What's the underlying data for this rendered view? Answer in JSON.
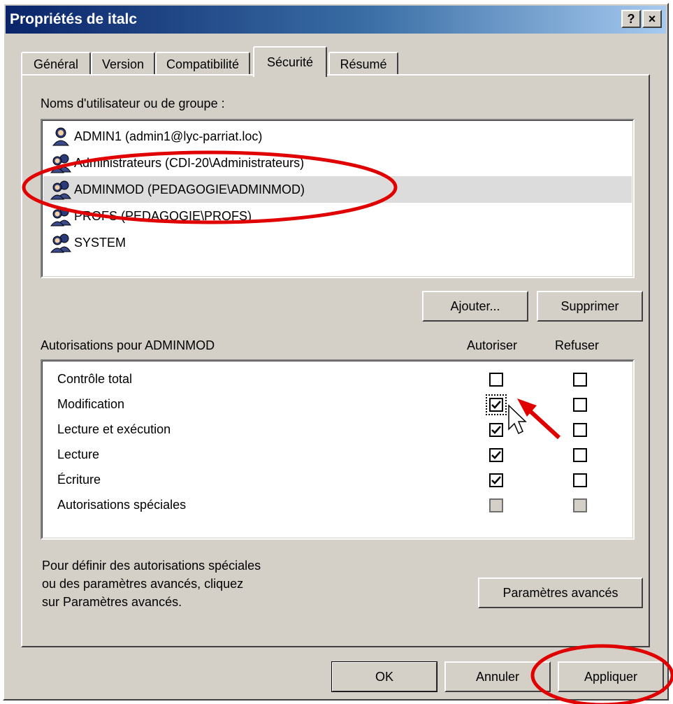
{
  "window": {
    "title": "Propriétés de italc",
    "help_label": "?",
    "close_label": "×"
  },
  "tabs": [
    {
      "label": "Général",
      "active": false
    },
    {
      "label": "Version",
      "active": false
    },
    {
      "label": "Compatibilité",
      "active": false
    },
    {
      "label": "Sécurité",
      "active": true
    },
    {
      "label": "Résumé",
      "active": false
    }
  ],
  "users": {
    "label": "Noms d'utilisateur ou de groupe :",
    "items": [
      {
        "name": "ADMIN1 (admin1@lyc-parriat.loc)",
        "icon": "user-icon",
        "selected": false
      },
      {
        "name": "Administrateurs (CDI-20\\Administrateurs)",
        "icon": "group-icon",
        "selected": false
      },
      {
        "name": "ADMINMOD (PEDAGOGIE\\ADMINMOD)",
        "icon": "group-icon",
        "selected": true
      },
      {
        "name": "PROFS (PEDAGOGIE\\PROFS)",
        "icon": "group-icon",
        "selected": false
      },
      {
        "name": "SYSTEM",
        "icon": "group-icon",
        "selected": false
      }
    ],
    "add_label": "Ajouter...",
    "remove_label": "Supprimer"
  },
  "permissions": {
    "label": "Autorisations pour ADMINMOD",
    "allow_header": "Autoriser",
    "deny_header": "Refuser",
    "rows": [
      {
        "name": "Contrôle total",
        "allow": "unchecked",
        "deny": "unchecked"
      },
      {
        "name": "Modification",
        "allow": "checked",
        "deny": "unchecked"
      },
      {
        "name": "Lecture et exécution",
        "allow": "checked",
        "deny": "unchecked"
      },
      {
        "name": "Lecture",
        "allow": "checked",
        "deny": "unchecked"
      },
      {
        "name": "Écriture",
        "allow": "checked",
        "deny": "unchecked"
      },
      {
        "name": "Autorisations spéciales",
        "allow": "disabled",
        "deny": "disabled"
      }
    ]
  },
  "advanced": {
    "desc_line1": "Pour définir des autorisations spéciales",
    "desc_line2": "ou des paramètres avancés, cliquez",
    "desc_line3": "sur Paramètres avancés.",
    "button_label": "Paramètres avancés"
  },
  "footer": {
    "ok_label": "OK",
    "cancel_label": "Annuler",
    "apply_label": "Appliquer"
  },
  "colors": {
    "annotation_red": "#e00000",
    "title_bar": "#0a246a",
    "face": "#d4d0c8",
    "selected_row": "#dcdcdc"
  }
}
